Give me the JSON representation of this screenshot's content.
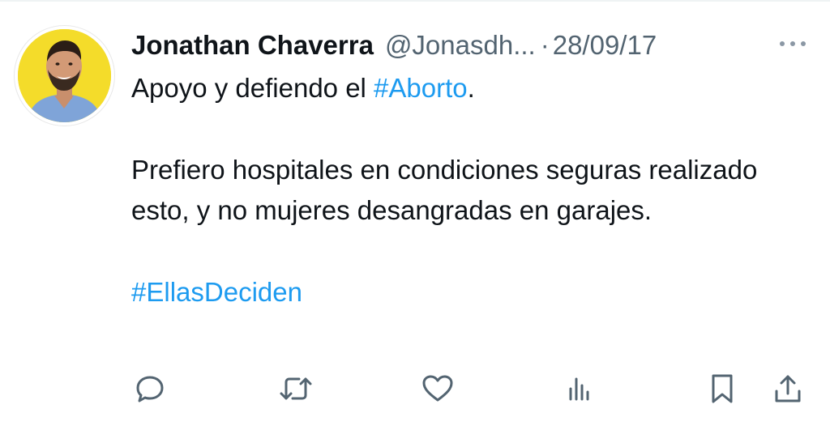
{
  "tweet": {
    "author": {
      "display_name": "Jonathan Chaverra",
      "handle": "@Jonasdh...",
      "avatar_bg": "#f4dc2a"
    },
    "separator": "·",
    "date": "28/09/17",
    "text": {
      "line1_prefix": "Apoyo y defiendo el ",
      "line1_hashtag": "#Aborto",
      "line1_suffix": ".",
      "paragraph2": "Prefiero hospitales en condiciones seguras realizado esto, y no mujeres desangradas en garajes.",
      "closing_hashtag": "#EllasDeciden"
    },
    "hashtag_color": "#1d9bf0",
    "actions": [
      {
        "name": "reply",
        "icon": "speech-bubble-icon"
      },
      {
        "name": "retweet",
        "icon": "retweet-icon"
      },
      {
        "name": "like",
        "icon": "heart-icon"
      },
      {
        "name": "views",
        "icon": "bar-chart-icon"
      },
      {
        "name": "bookmark",
        "icon": "bookmark-icon"
      },
      {
        "name": "share",
        "icon": "share-icon"
      }
    ]
  }
}
